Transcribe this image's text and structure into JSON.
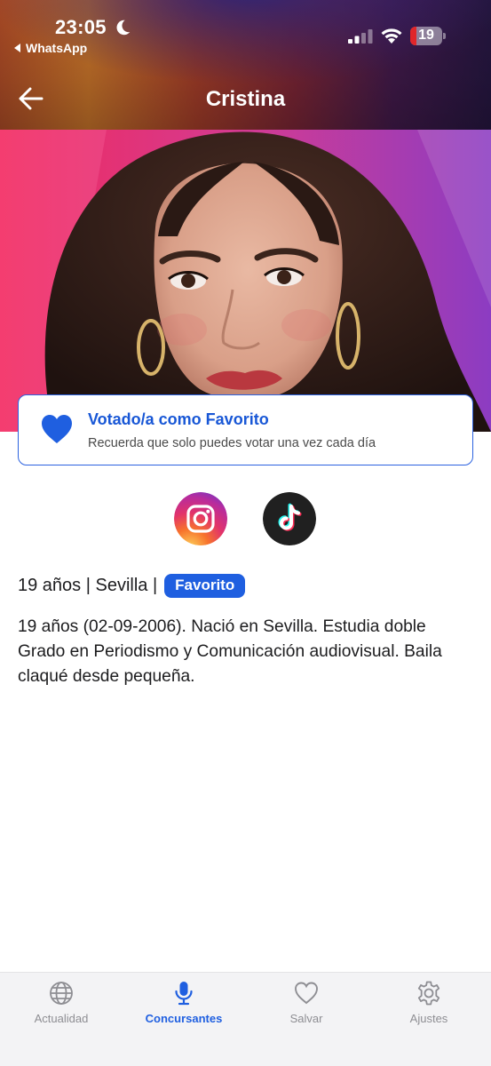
{
  "status_bar": {
    "time": "23:05",
    "back_app": "WhatsApp",
    "battery_level": "19"
  },
  "header": {
    "title": "Cristina"
  },
  "favorite_card": {
    "title": "Votado/a como Favorito",
    "subtitle": "Recuerda que solo puedes votar una vez cada día",
    "accent": "#1857d6"
  },
  "social": {
    "instagram_icon": "instagram-icon",
    "tiktok_icon": "tiktok-icon"
  },
  "profile": {
    "meta": "19 años | Sevilla |",
    "badge": "Favorito",
    "bio": "19 años (02-09-2006).  Nació en Sevilla. Estudia doble Grado en Periodismo y Comunicación audiovisual. Baila claqué desde pequeña."
  },
  "tab_bar": {
    "active_color": "#1f5fe0",
    "items": [
      {
        "label": "Actualidad",
        "icon": "globe-icon"
      },
      {
        "label": "Concursantes",
        "icon": "microphone-icon",
        "active": true
      },
      {
        "label": "Salvar",
        "icon": "heart-outline-icon"
      },
      {
        "label": "Ajustes",
        "icon": "gear-icon"
      }
    ]
  }
}
